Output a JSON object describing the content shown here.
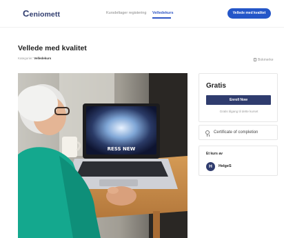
{
  "nav": {
    "logo_initial": "C",
    "logo_rest": "eniomett",
    "links": [
      "Kursdeltager registering",
      "Velledekurs"
    ],
    "cta_label": "Vellede med kvalitet"
  },
  "course": {
    "title": "Vellede med kvalitet",
    "category_label": "Kategorier:",
    "category_value": "Velledekurs",
    "bookmark_label": "Bokmerke"
  },
  "sidebar": {
    "price": "Gratis",
    "enroll_label": "Enroll Now",
    "free_note": "Gratis tilgang til dette kurset",
    "certificate_label": "Certificate of completion",
    "author_heading": "Et kurs av",
    "author_initial": "H",
    "author_name": "HelgeS"
  },
  "hero": {
    "laptop_screen_text": "RESS NEW",
    "icon": "elderly-woman-laptop-photo"
  }
}
